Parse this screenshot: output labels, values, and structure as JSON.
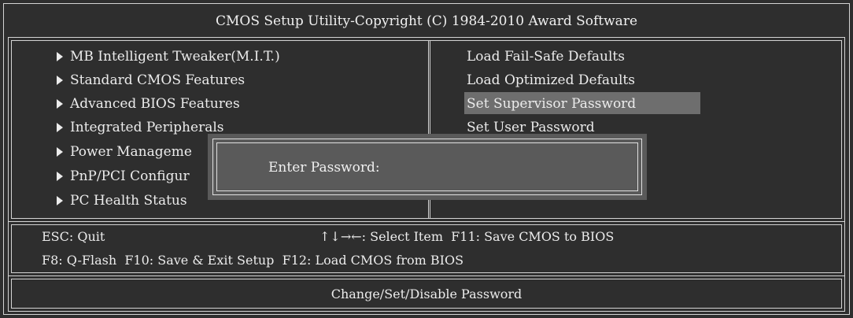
{
  "header": {
    "title": "CMOS Setup Utility-Copyright (C) 1984-2010 Award Software"
  },
  "menu_left": [
    {
      "label": "MB Intelligent Tweaker(M.I.T.)"
    },
    {
      "label": "Standard CMOS Features"
    },
    {
      "label": "Advanced BIOS Features"
    },
    {
      "label": "Integrated Peripherals"
    },
    {
      "label": "Power Manageme"
    },
    {
      "label": "PnP/PCI Configur"
    },
    {
      "label": "PC Health Status"
    }
  ],
  "menu_right": [
    {
      "label": "Load Fail-Safe Defaults"
    },
    {
      "label": "Load Optimized Defaults"
    },
    {
      "label": "Set Supervisor Password"
    },
    {
      "label": "Set User Password"
    }
  ],
  "selected_item": "Set Supervisor Password",
  "dialog": {
    "label": "Enter Password:",
    "value": ""
  },
  "help": {
    "esc": "ESC: Quit",
    "nav": "↑↓→←: Select Item  F11: Save CMOS to BIOS",
    "keys": "F8: Q-Flash  F10: Save & Exit Setup  F12: Load CMOS from BIOS"
  },
  "status": {
    "text": "Change/Set/Disable Password"
  },
  "colors": {
    "background": "#2e2e2e",
    "highlight": "#6e6e6e",
    "dialog": "#5a5a5a",
    "text": "#ececec"
  }
}
